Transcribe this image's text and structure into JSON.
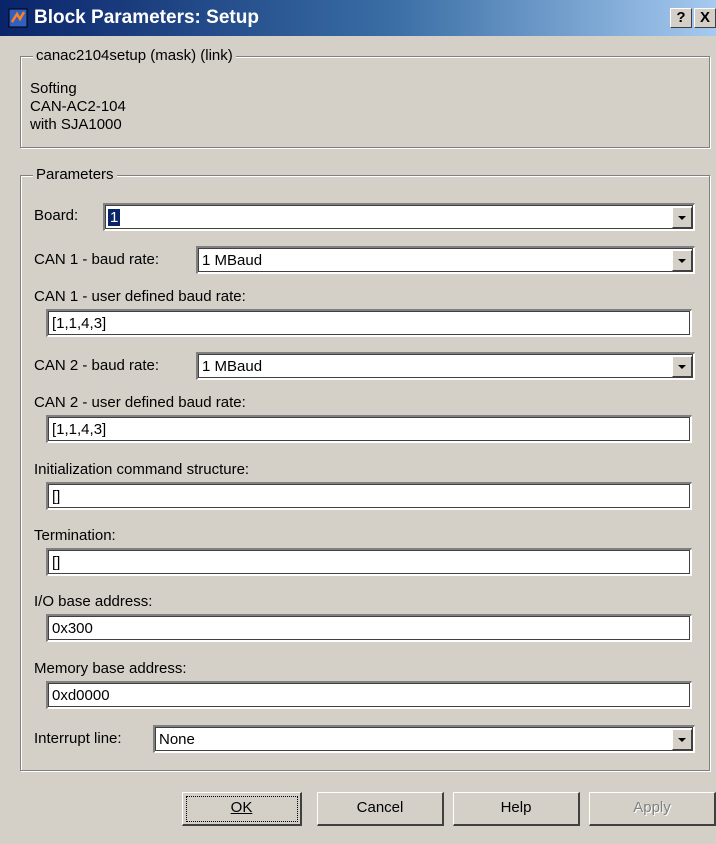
{
  "window": {
    "title": "Block Parameters: Setup",
    "help_btn": "?",
    "close_btn": "X"
  },
  "mask": {
    "legend": "canac2104setup (mask) (link)",
    "description": [
      "Softing",
      "CAN-AC2-104",
      "with SJA1000"
    ]
  },
  "parameters": {
    "legend": "Parameters",
    "board_label": "Board:",
    "board_value": "1",
    "can1_baud_label": "CAN 1 - baud rate:",
    "can1_baud_value": "1 MBaud",
    "can1_user_label": "CAN 1 - user defined baud rate:",
    "can1_user_value": "[1,1,4,3]",
    "can2_baud_label": "CAN 2 - baud rate:",
    "can2_baud_value": "1 MBaud",
    "can2_user_label": "CAN 2 - user defined baud rate:",
    "can2_user_value": "[1,1,4,3]",
    "init_label": "Initialization command structure:",
    "init_value": "[]",
    "term_label": "Termination:",
    "term_value": "[]",
    "io_label": "I/O base address:",
    "io_value": "0x300",
    "mem_label": "Memory base address:",
    "mem_value": "0xd0000",
    "irq_label": "Interrupt line:",
    "irq_value": "None"
  },
  "buttons": {
    "ok": "OK",
    "cancel": "Cancel",
    "help": "Help",
    "apply": "Apply"
  }
}
